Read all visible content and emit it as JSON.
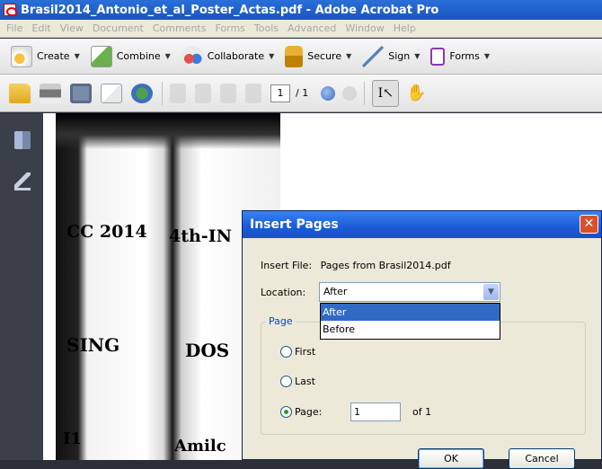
{
  "window": {
    "title": "Brasil2014_Antonio_et_al_Poster_Actas.pdf - Adobe Acrobat Pro"
  },
  "menu": [
    "File",
    "Edit",
    "View",
    "Document",
    "Comments",
    "Forms",
    "Tools",
    "Advanced",
    "Window",
    "Help"
  ],
  "toolbar_tasks": [
    {
      "label": "Create",
      "icon": "create-icon"
    },
    {
      "label": "Combine",
      "icon": "combine-icon"
    },
    {
      "label": "Collaborate",
      "icon": "collaborate-icon"
    },
    {
      "label": "Secure",
      "icon": "lock-icon"
    },
    {
      "label": "Sign",
      "icon": "pen-icon"
    },
    {
      "label": "Forms",
      "icon": "forms-icon"
    }
  ],
  "navigation": {
    "current_page": "1",
    "total_pages": "/ 1"
  },
  "document": {
    "visible_text": [
      "CC 2014",
      "4th-IN",
      "SING",
      "DOS",
      "I1",
      "Amilc"
    ]
  },
  "dialog": {
    "title": "Insert Pages",
    "close_glyph": "✕",
    "insert_file_label": "Insert File:",
    "insert_file_value": "Pages from Brasil2014.pdf",
    "location_label": "Location:",
    "location_value": "After",
    "location_options": [
      "After",
      "Before"
    ],
    "page_group_label": "Page",
    "radio_first": "First",
    "radio_last": "Last",
    "radio_page": "Page:",
    "selected_radio": "Page:",
    "page_number": "1",
    "of_text": "of 1",
    "ok_label": "OK",
    "cancel_label": "Cancel"
  }
}
